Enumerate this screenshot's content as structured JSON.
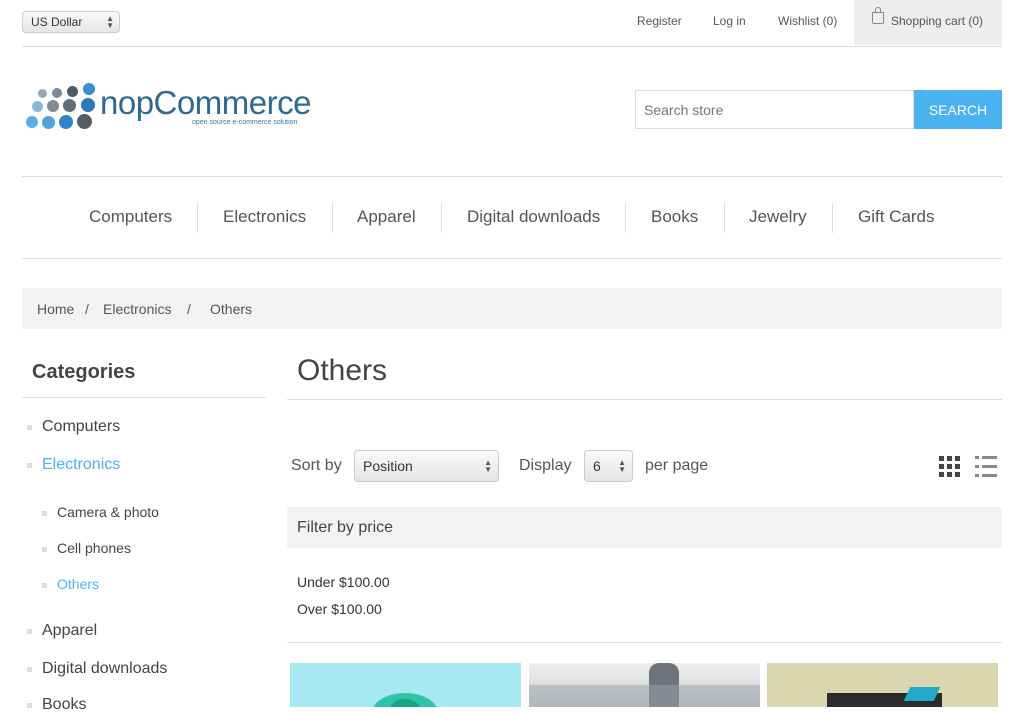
{
  "header": {
    "currency": "US Dollar",
    "links": [
      "Register",
      "Log in",
      "Wishlist (0)"
    ],
    "cart": "Shopping cart (0)"
  },
  "logo": {
    "name": "nopCommerce",
    "tagline": "open source e-commerce solution"
  },
  "search": {
    "placeholder": "Search store",
    "button": "SEARCH"
  },
  "menu": [
    "Computers",
    "Electronics",
    "Apparel",
    "Digital downloads",
    "Books",
    "Jewelry",
    "Gift Cards"
  ],
  "breadcrumb": [
    "Home",
    "/",
    "Electronics",
    "/",
    "Others"
  ],
  "sidebar": {
    "title": "Categories",
    "items": [
      "Computers",
      "Electronics",
      "Apparel",
      "Digital downloads",
      "Books"
    ],
    "subitems": [
      "Camera & photo",
      "Cell phones",
      "Others"
    ],
    "active_item": "Electronics",
    "active_subitem": "Others"
  },
  "main": {
    "title": "Others",
    "sort_label": "Sort by",
    "sort_value": "Position",
    "display_label": "Display",
    "display_value": "6",
    "per_page": "per page",
    "filter_title": "Filter by price",
    "price_ranges": [
      "Under $100.00",
      "Over $100.00"
    ]
  },
  "colors": {
    "accent": "#4ab2f1",
    "text": "#444444",
    "panel": "#f3f3f3"
  },
  "icons": [
    "cart-bag-icon",
    "grid-view-icon",
    "list-view-icon"
  ]
}
